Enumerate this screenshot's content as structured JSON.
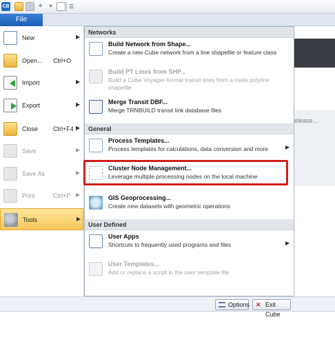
{
  "toolbar": {
    "app_icon_text": "CB",
    "icons": [
      "app-icon",
      "open-folder-icon",
      "save-icon",
      "wand-icon",
      "dropdown-icon",
      "document-icon",
      "customize-icon"
    ]
  },
  "file_tab": {
    "label": "File"
  },
  "left_menu": {
    "items": [
      {
        "label": "New",
        "shortcut": "",
        "arrow": "▶",
        "icon": "new-document-icon",
        "enabled": true
      },
      {
        "label": "Open...",
        "shortcut": "Ctrl+O",
        "arrow": "",
        "icon": "open-folder-icon",
        "enabled": true
      },
      {
        "label": "Import",
        "shortcut": "",
        "arrow": "▶",
        "icon": "import-icon",
        "enabled": true
      },
      {
        "label": "Export",
        "shortcut": "",
        "arrow": "▶",
        "icon": "export-icon",
        "enabled": true
      },
      {
        "label": "Close",
        "shortcut": "Ctrl+F4",
        "arrow": "▶",
        "icon": "close-folder-icon",
        "enabled": true
      },
      {
        "label": "Save",
        "shortcut": "",
        "arrow": "▶",
        "icon": "save-icon",
        "enabled": false
      },
      {
        "label": "Save As",
        "shortcut": "",
        "arrow": "▶",
        "icon": "save-as-icon",
        "enabled": false
      },
      {
        "label": "Print",
        "shortcut": "Ctrl+P",
        "arrow": "▶",
        "icon": "print-icon",
        "enabled": false
      },
      {
        "label": "Tools",
        "shortcut": "",
        "arrow": "▶",
        "icon": "gears-icon",
        "enabled": true,
        "selected": true
      }
    ]
  },
  "submenu": {
    "sections": {
      "networks": "Networks",
      "general": "General",
      "user_defined": "User Defined"
    },
    "items": {
      "build_network": {
        "title": "Build Network from Shape...",
        "desc": "Create a new Cube network from a line shapefile or feature class"
      },
      "build_pt": {
        "title": "Build PT Lines from SHP...",
        "desc": "Build a Cube Voyager-format transit lines from a route polyline shapefile"
      },
      "merge_transit": {
        "title": "Merge Transit DBF...",
        "desc": "Merge TRNBUILD transit link database files"
      },
      "process_templates": {
        "title": "Process Templates...",
        "desc": "Process templates for calculations, data conversion and more",
        "arrow": "▶"
      },
      "cluster_node": {
        "title": "Cluster Node Management...",
        "desc": "Leverage multiple processing nodes on the local machine"
      },
      "gis_geoprocessing": {
        "title": "GIS Geoprocessing...",
        "desc": "Create new datasets with geometric operations"
      },
      "user_apps": {
        "title": "User Apps",
        "desc": "Shortcuts to frequently used programs and files",
        "arrow": "▶"
      },
      "user_templates": {
        "title": "User Templates...",
        "desc": "Add or replace a script in the user template file"
      }
    }
  },
  "background": {
    "partial_text": "elease..."
  },
  "bottom_bar": {
    "options_label": "Options",
    "exit_label": "Exit Cube",
    "exit_glyph": "✕"
  },
  "colors": {
    "file_tab": "#1c5fb6",
    "selected_item": "#f7c75a",
    "highlight_box": "#d01c1c"
  }
}
